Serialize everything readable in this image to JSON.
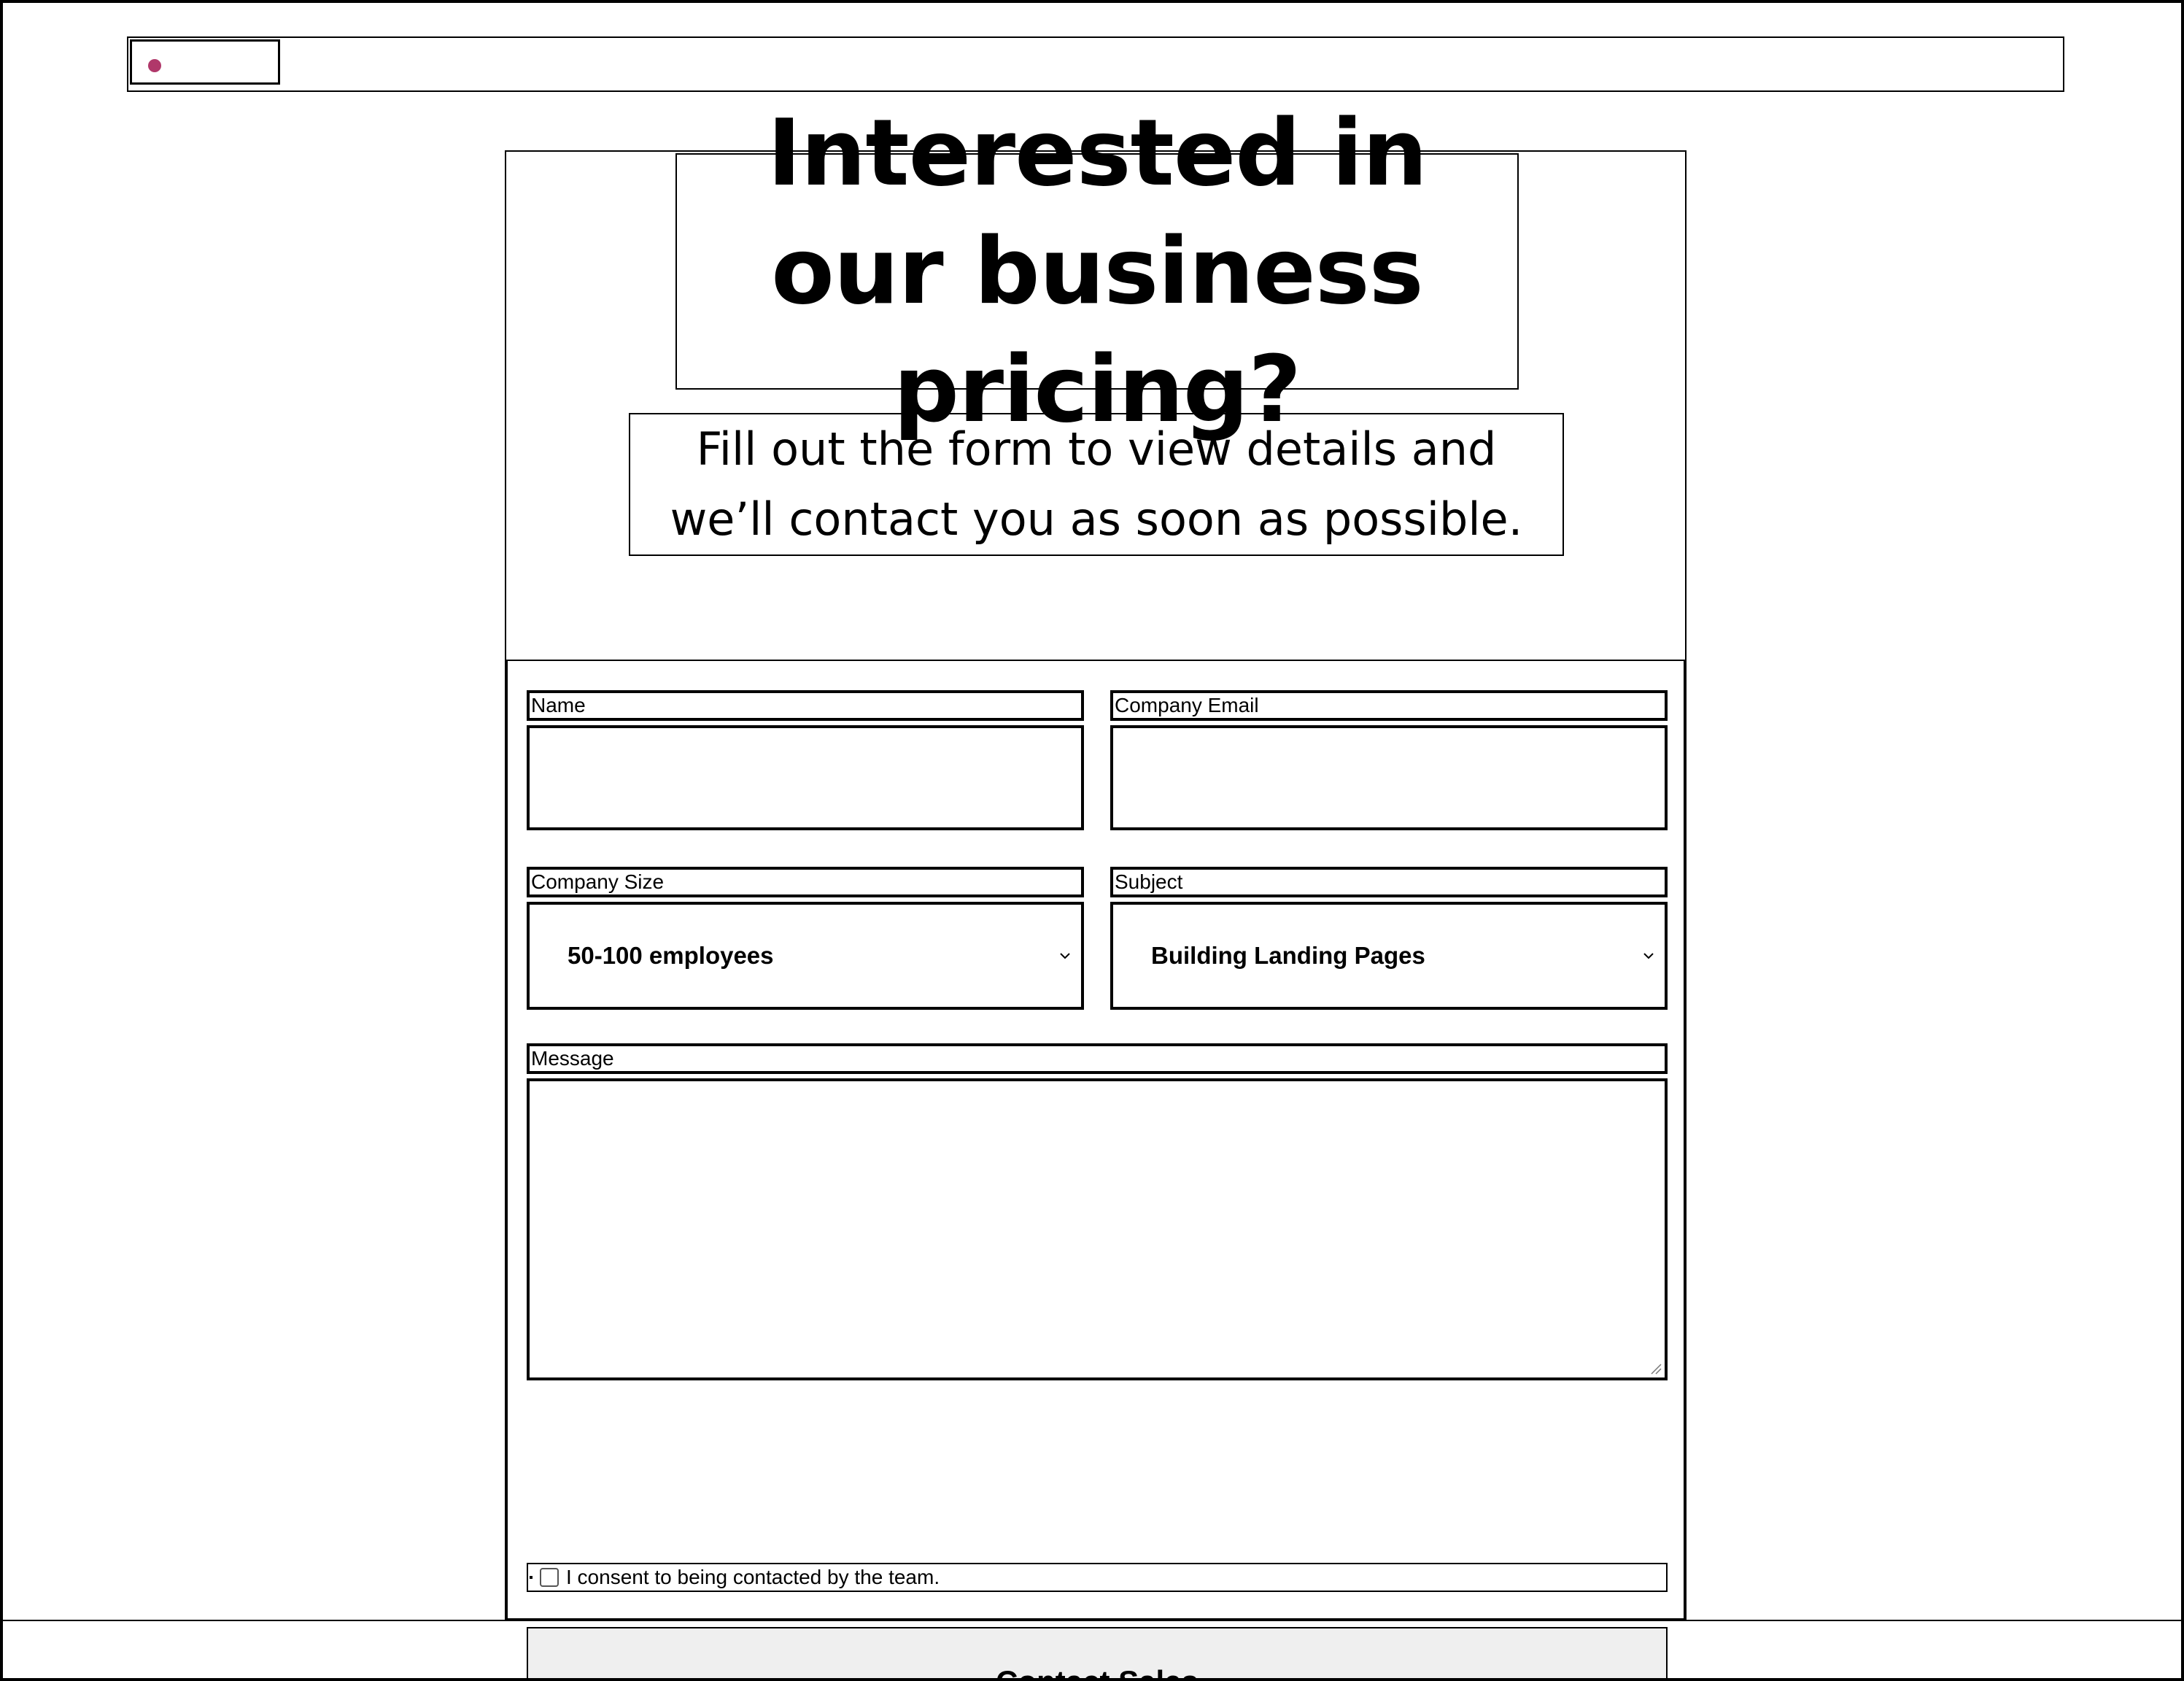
{
  "header": {
    "logo_color": "#b0386a"
  },
  "hero": {
    "title": "Interested in our business pricing?",
    "subtitle": "Fill out the form to view details and we’ll contact you as soon as possible."
  },
  "form": {
    "name": {
      "label": "Name",
      "value": ""
    },
    "email": {
      "label": "Company Email",
      "value": ""
    },
    "company_size": {
      "label": "Company Size",
      "selected": "50-100 employees"
    },
    "subject": {
      "label": "Subject",
      "selected": "Building Landing Pages"
    },
    "message": {
      "label": "Message",
      "value": ""
    },
    "consent": {
      "label": "I consent to being contacted by the team.",
      "checked": false
    },
    "submit_label": "Contact Sales"
  }
}
